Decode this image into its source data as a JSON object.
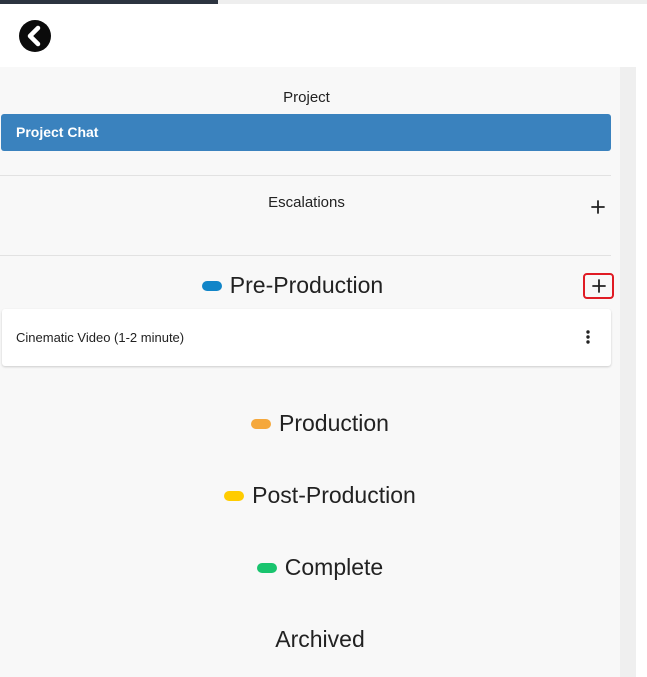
{
  "topbar": {
    "back_icon": "chevron-left-circle-icon"
  },
  "project": {
    "heading": "Project",
    "chat_label": "Project Chat"
  },
  "escalations": {
    "heading": "Escalations",
    "add_icon": "plus-icon"
  },
  "stages": {
    "pre_production": {
      "label": "Pre-Production",
      "color": "#1185c8",
      "add_icon": "plus-icon",
      "cards": [
        {
          "title": "Cinematic Video (1-2 minute)",
          "menu_icon": "kebab-menu-icon"
        }
      ]
    },
    "production": {
      "label": "Production",
      "color": "#f5a83c"
    },
    "post_production": {
      "label": "Post-Production",
      "color": "#ffcc00"
    },
    "complete": {
      "label": "Complete",
      "color": "#19c46e"
    },
    "archived": {
      "label": "Archived"
    }
  },
  "colors": {
    "accent": "#3a82be",
    "highlight": "#e01b24"
  }
}
